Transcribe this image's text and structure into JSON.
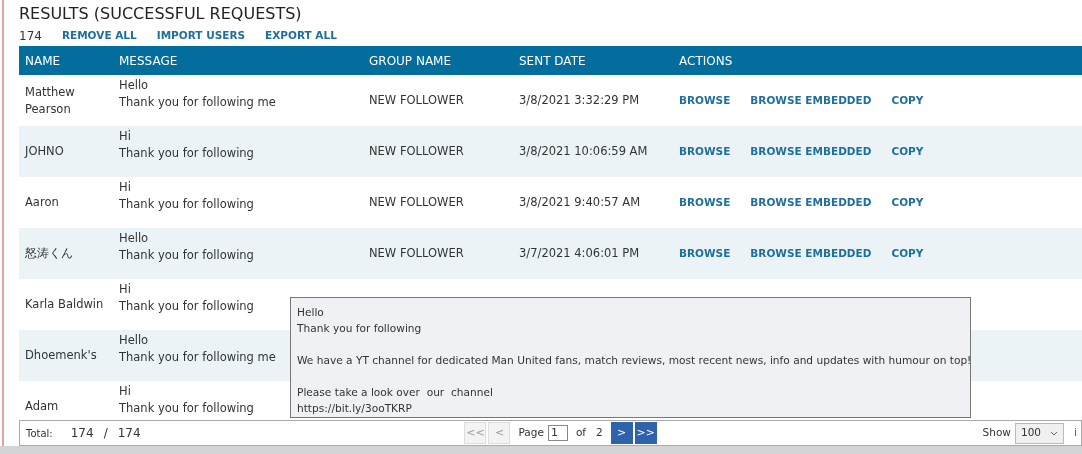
{
  "title": "RESULTS (SUCCESSFUL REQUESTS)",
  "toolbar": {
    "count": "174",
    "links": [
      "REMOVE ALL",
      "IMPORT USERS",
      "EXPORT ALL"
    ]
  },
  "table": {
    "columns": [
      "NAME",
      "MESSAGE",
      "GROUP NAME",
      "SENT DATE",
      "ACTIONS"
    ],
    "rows": [
      {
        "name": "Matthew Pearson",
        "message": [
          "Hello",
          "Thank you for following me"
        ],
        "group": "NEW FOLLOWER",
        "date": "3/8/2021 3:32:29 PM",
        "actions": [
          "BROWSE",
          "BROWSE EMBEDDED",
          "COPY"
        ]
      },
      {
        "name": "JOHNO",
        "message": [
          "Hi",
          "Thank you for following"
        ],
        "group": "NEW FOLLOWER",
        "date": "3/8/2021 10:06:59 AM",
        "actions": [
          "BROWSE",
          "BROWSE EMBEDDED",
          "COPY"
        ]
      },
      {
        "name": "Aaron",
        "message": [
          "Hi",
          "Thank you for following"
        ],
        "group": "NEW FOLLOWER",
        "date": "3/8/2021 9:40:57 AM",
        "actions": [
          "BROWSE",
          "BROWSE EMBEDDED",
          "COPY"
        ]
      },
      {
        "name": "怒涛くん",
        "message": [
          "Hello",
          "Thank you for following"
        ],
        "group": "NEW FOLLOWER",
        "date": "3/7/2021 4:06:01 PM",
        "actions": [
          "BROWSE",
          "BROWSE EMBEDDED",
          "COPY"
        ]
      },
      {
        "name": "Karla Baldwin",
        "message": [
          "Hi",
          "Thank you for following"
        ]
      },
      {
        "name": "Dhoemenk's",
        "message": [
          "Hello",
          "Thank you for following me"
        ]
      },
      {
        "name": "Adam",
        "message": [
          "Hi",
          "Thank you for following"
        ]
      }
    ]
  },
  "tooltip": {
    "paragraphs": [
      [
        "Hello",
        "Thank you for following"
      ],
      [
        "We have a YT channel for dedicated Man United fans, match reviews, most recent news, info and updates with humour on top!"
      ],
      [
        "Please take a look over  our  channel",
        "https://bit.ly/3ooTKRP"
      ]
    ]
  },
  "footer": {
    "total_label": "Total:",
    "total": "174",
    "separator": "/",
    "total_all": "174",
    "pager": [
      {
        "label": "<<",
        "disabled": true
      },
      {
        "label": "<",
        "disabled": true
      }
    ],
    "page_label": "Page",
    "page": "1",
    "of_label": "of",
    "pages": "2",
    "pager_next": [
      {
        "label": ">",
        "disabled": false
      },
      {
        "label": ">>",
        "disabled": false
      }
    ],
    "show_label": "Show",
    "show_value": "100",
    "edge_text": "i"
  }
}
